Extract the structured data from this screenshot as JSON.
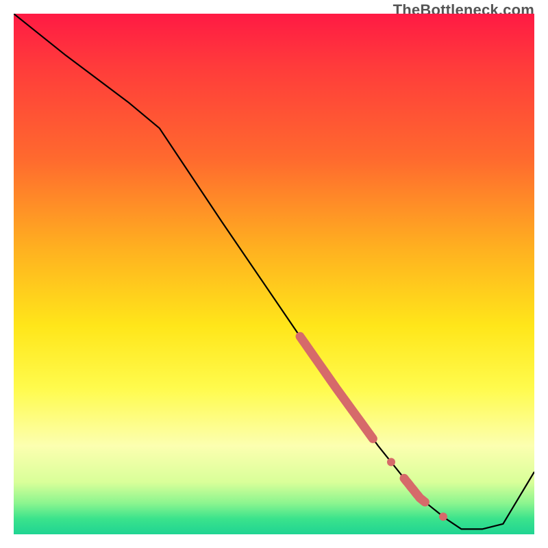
{
  "watermark": "TheBottleneck.com",
  "chart_data": {
    "type": "line",
    "title": "",
    "xlabel": "",
    "ylabel": "",
    "xlim": [
      0,
      100
    ],
    "ylim": [
      0,
      100
    ],
    "grid": false,
    "legend": false,
    "series": [
      {
        "name": "curve",
        "x": [
          0,
          10,
          22,
          28,
          40,
          55,
          62,
          70,
          78,
          83,
          86,
          90,
          94,
          100
        ],
        "y": [
          100,
          92,
          83,
          78,
          60,
          38,
          28,
          17,
          7,
          3,
          1,
          1,
          2,
          12
        ],
        "color": "#000000"
      }
    ],
    "highlight_points": {
      "color": "#d66a6a",
      "segments": [
        {
          "x_start": 55,
          "x_end": 69,
          "style": "thick-line"
        },
        {
          "x_start": 72,
          "x_end": 73,
          "style": "dot"
        },
        {
          "x_start": 75,
          "x_end": 79,
          "style": "thick-line"
        },
        {
          "x_start": 82,
          "x_end": 83,
          "style": "dot"
        }
      ]
    },
    "background_gradient": {
      "direction": "vertical",
      "stops": [
        {
          "pos": 0.0,
          "color": "#ff1a44"
        },
        {
          "pos": 0.28,
          "color": "#ff6a2e"
        },
        {
          "pos": 0.6,
          "color": "#ffe61a"
        },
        {
          "pos": 0.9,
          "color": "#d9ff99"
        },
        {
          "pos": 1.0,
          "color": "#1fd492"
        }
      ]
    }
  }
}
